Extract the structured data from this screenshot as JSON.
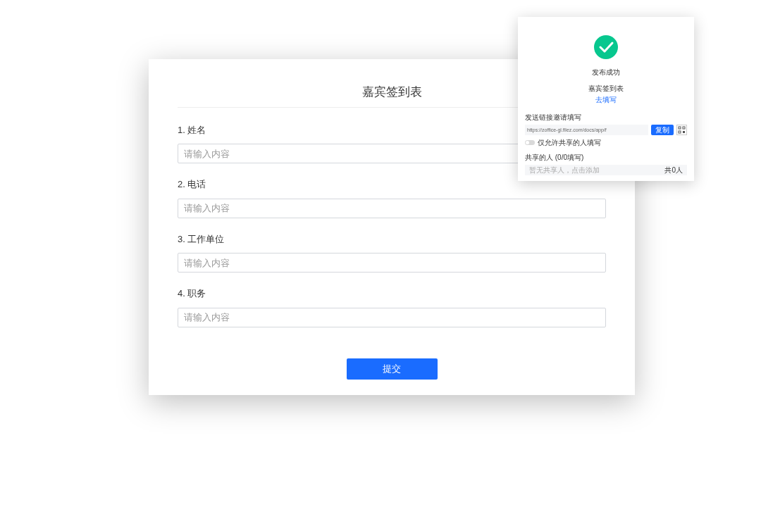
{
  "form": {
    "title": "嘉宾签到表",
    "questions": [
      {
        "label": "1. 姓名",
        "placeholder": "请输入内容"
      },
      {
        "label": "2. 电话",
        "placeholder": "请输入内容"
      },
      {
        "label": "3. 工作单位",
        "placeholder": "请输入内容"
      },
      {
        "label": "4. 职务",
        "placeholder": "请输入内容"
      }
    ],
    "submit": "提交"
  },
  "popup": {
    "status": "发布成功",
    "form_name": "嘉宾签到表",
    "fill_link": "去填写",
    "send_label": "发送链接邀请填写",
    "url": "https://zoffice-gl.filez.com/docs/app/f",
    "copy": "复制",
    "toggle": {
      "label": "仅允许共享的人填写",
      "on": false
    },
    "shared_label": "共享的人 (0/0填写)",
    "shared_hint": "暂无共享人，点击添加",
    "shared_count": "共0人"
  }
}
